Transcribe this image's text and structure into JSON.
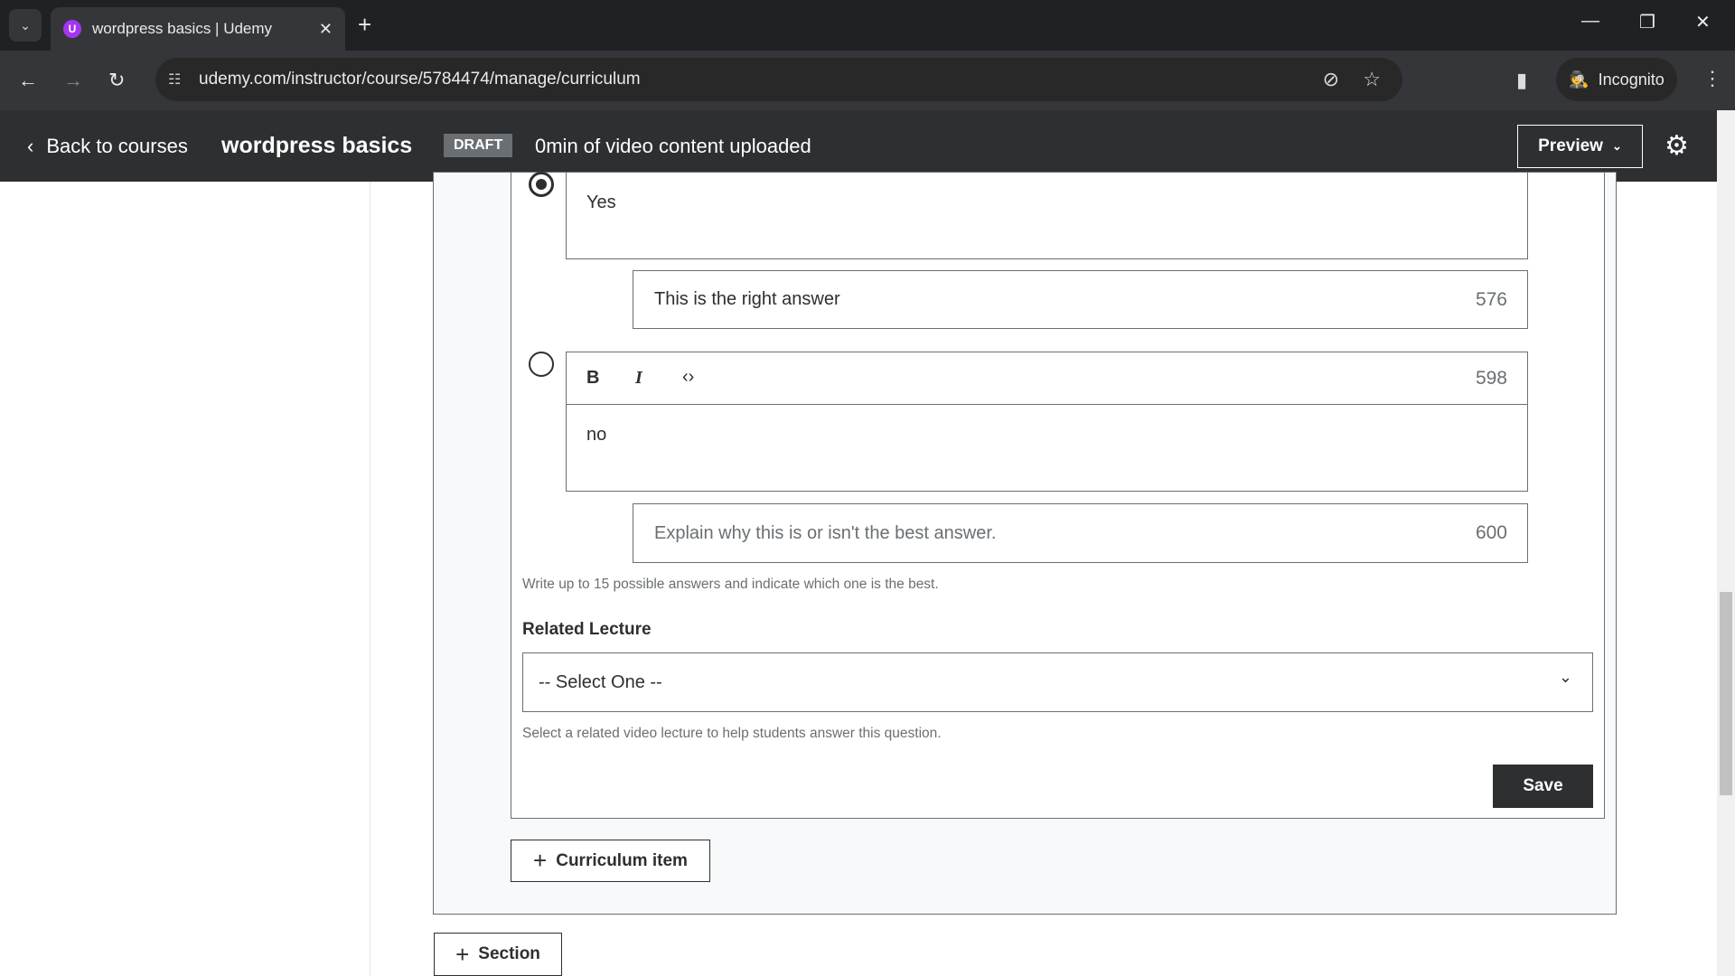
{
  "browser": {
    "tab_title": "wordpress basics | Udemy",
    "tab_favicon": "U",
    "url": "udemy.com/instructor/course/5784474/manage/curriculum",
    "incognito_label": "Incognito"
  },
  "header": {
    "back_label": "Back to courses",
    "course_title": "wordpress basics",
    "status_badge": "DRAFT",
    "upload_status": "0min of video content uploaded",
    "preview_label": "Preview"
  },
  "quiz": {
    "answers": [
      {
        "text": "Yes",
        "selected": true,
        "explanation": "This is the right answer",
        "explanation_count": "576"
      },
      {
        "text": "no",
        "selected": false,
        "editor_count": "598",
        "explanation_placeholder": "Explain why this is or isn't the best answer.",
        "explanation_count": "600"
      }
    ],
    "answers_help": "Write up to 15 possible answers and indicate which one is the best.",
    "related_lecture_label": "Related Lecture",
    "related_lecture_value": "-- Select One --",
    "related_lecture_help": "Select a related video lecture to help students answer this question.",
    "save_label": "Save"
  },
  "curriculum_item_label": "Curriculum item",
  "section_label": "Section",
  "colors": {
    "header_bg": "#2d2f31",
    "accent": "#2d2f31",
    "badge": "#6a6f73",
    "favicon": "#a435f0"
  }
}
